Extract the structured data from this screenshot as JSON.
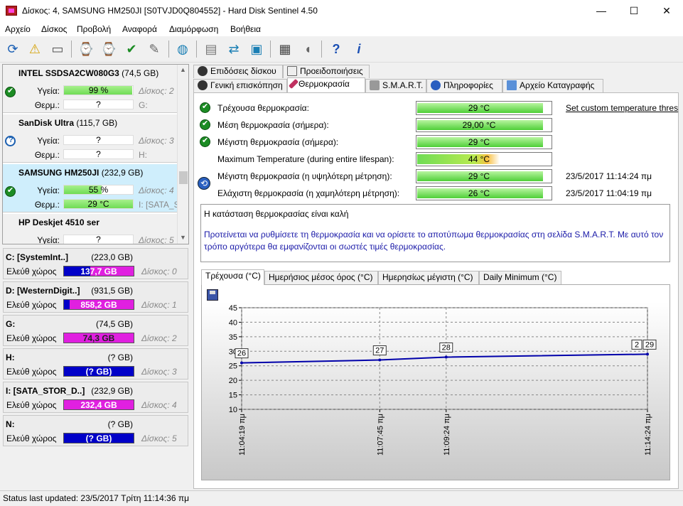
{
  "window": {
    "title": "Δίσκος: 4, SAMSUNG HM250JI [S0TVJD0Q804552]  -  Hard Disk Sentinel 4.50",
    "minimize": "—",
    "maximize": "☐",
    "close": "✕"
  },
  "menu": [
    {
      "label": "Αρχείο"
    },
    {
      "label": "Δίσκος"
    },
    {
      "label": "Προβολή"
    },
    {
      "label": "Αναφορά"
    },
    {
      "label": "Διαμόρφωση"
    },
    {
      "label": "Βοήθεια"
    }
  ],
  "toolbar": {
    "icons": [
      "refresh-icon",
      "warning-icon",
      "disk-icon",
      "disk-test-icon",
      "disk-test-icon",
      "disk-ok-icon",
      "disk-config-icon",
      "globe-icon",
      "report-icon",
      "sync-icon",
      "network-icon",
      "monitor-icon",
      "speaker-icon",
      "help-icon",
      "info-icon"
    ],
    "glyphs": [
      "⟳",
      "⚠",
      "▭",
      "⌚",
      "⌚",
      "✔",
      "✎",
      "◍",
      "▤",
      "⇄",
      "▣",
      "▦",
      "◖",
      "?",
      "i"
    ]
  },
  "disks": [
    {
      "name": "INTEL SSDSA2CW080G3",
      "capacity": "(74,5 GB)",
      "health_label": "Υγεία:",
      "health": "99 %",
      "health_pct": 99,
      "temp_label": "Θερμ.:",
      "temp": "?",
      "temp_pct": 0,
      "disk_no": "Δίσκος: 2",
      "drive": "G:",
      "status": "ok"
    },
    {
      "name": "SanDisk Ultra",
      "capacity": "(115,7 GB)",
      "health_label": "Υγεία:",
      "health": "?",
      "health_pct": 0,
      "temp_label": "Θερμ.:",
      "temp": "?",
      "temp_pct": 0,
      "disk_no": "Δίσκος: 3",
      "drive": "H:",
      "status": "unknown"
    },
    {
      "name": "SAMSUNG HM250JI",
      "capacity": "(232,9 GB)",
      "health_label": "Υγεία:",
      "health": "55 %",
      "health_pct": 55,
      "temp_label": "Θερμ.:",
      "temp": "29 °C",
      "temp_pct": 100,
      "disk_no": "Δίσκος: 4",
      "drive": "I: [SATA_S",
      "status": "ok"
    },
    {
      "name": "HP      Deskjet 4510 ser",
      "capacity": "",
      "health_label": "Υγεία:",
      "health": "?",
      "health_pct": 0,
      "temp_label": "",
      "temp": "",
      "temp_pct": 0,
      "disk_no": "Δίσκος: 5",
      "drive": "",
      "status": "unknown"
    }
  ],
  "volumes": [
    {
      "name": "C: [SystemInt..]",
      "size": "(223,0 GB)",
      "free_label": "Ελεύθ χώρος",
      "free": "137,7 GB",
      "free_pct": 62,
      "color": "#e020e0",
      "disk": "Δίσκος: 0"
    },
    {
      "name": "D: [WesternDigit..]",
      "size": "(931,5 GB)",
      "free_label": "Ελεύθ χώρος",
      "free": "858,2 GB",
      "free_pct": 92,
      "color": "#e020e0",
      "disk": "Δίσκος: 1"
    },
    {
      "name": "G:",
      "size": "(74,5 GB)",
      "free_label": "Ελεύθ χώρος",
      "free": "74,3 GB",
      "free_pct": 100,
      "color": "#e020e0",
      "disk": "Δίσκος: 2"
    },
    {
      "name": "H:",
      "size": "(? GB)",
      "free_label": "Ελεύθ χώρος",
      "free": "(? GB)",
      "free_pct": 0,
      "color": "#e020e0",
      "disk": "Δίσκος: 3"
    },
    {
      "name": "I: [SATA_STOR_D..]",
      "size": "(232,9 GB)",
      "free_label": "Ελεύθ χώρος",
      "free": "232,4 GB",
      "free_pct": 100,
      "color": "#e020e0",
      "disk": "Δίσκος: 4"
    },
    {
      "name": "N:",
      "size": "(? GB)",
      "free_label": "Ελεύθ χώρος",
      "free": "(? GB)",
      "free_pct": 0,
      "color": "#e020e0",
      "disk": "Δίσκος: 5"
    }
  ],
  "tabs_top": [
    {
      "label": "Επιδόσεις δίσκου",
      "icon": "gauge-icon"
    },
    {
      "label": "Προειδοποιήσεις",
      "icon": "document-icon"
    }
  ],
  "tabs_main": [
    {
      "label": "Γενική επισκόπηση",
      "icon": "gauge-icon"
    },
    {
      "label": "Θερμοκρασία",
      "icon": "thermometer-icon",
      "active": true
    },
    {
      "label": "S.M.A.R.T.",
      "icon": "disk-icon"
    },
    {
      "label": "Πληροφορίες",
      "icon": "info-icon"
    },
    {
      "label": "Αρχείο Καταγραφής",
      "icon": "log-icon"
    }
  ],
  "temps": [
    {
      "label": "Τρέχουσα θερμοκρασία:",
      "value": "29 °C",
      "fill_pct": 93,
      "ok": true,
      "extra": "Set custom temperature thres"
    },
    {
      "label": "Μέση θερμοκρασία (σήμερα):",
      "value": "29,00 °C",
      "fill_pct": 93,
      "ok": true,
      "extra": ""
    },
    {
      "label": "Μέγιστη θερμοκρασία (σήμερα):",
      "value": "29 °C",
      "fill_pct": 93,
      "ok": true,
      "extra": ""
    },
    {
      "label": "Maximum Temperature (during entire lifespan):",
      "value": "44 °C",
      "fill_pct": 76,
      "ok": false,
      "warm": true,
      "extra": ""
    },
    {
      "label": "Μέγιστη θερμοκρασία (η υψηλότερη μέτρηση):",
      "value": "29 °C",
      "fill_pct": 93,
      "ok": false,
      "extra": "23/5/2017 11:14:24 πμ"
    },
    {
      "label": "Ελάχιστη θερμοκρασία (η χαμηλότερη μέτρηση):",
      "value": "26 °C",
      "fill_pct": 93,
      "ok": false,
      "extra": "23/5/2017 11:04:19 πμ"
    }
  ],
  "info": {
    "status": "Η κατάσταση θερμοκρασίας είναι καλή",
    "advice": "Προτείνεται να ρυθμίσετε τη θερμοκρασία και να ορίσετε το αποτύπωμα θερμοκρασίας στη σελίδα S.M.A.R.T. Με αυτό τον τρόπο αργότερα θα εμφανίζονται οι σωστές τιμές θερμοκρασίας."
  },
  "graph_tabs": [
    {
      "label": "Τρέχουσα (°C)",
      "active": true
    },
    {
      "label": "Ημερήσιος μέσος όρος (°C)"
    },
    {
      "label": "Ημερησίως μέγιστη (°C)"
    },
    {
      "label": "Daily Minimum (°C)"
    }
  ],
  "chart_data": {
    "type": "line",
    "x": [
      "11:04:19 πμ",
      "11:07:45 πμ",
      "11:09:24 πμ",
      "11:14:24 πμ"
    ],
    "x_minutes": [
      0,
      3.43,
      5.08,
      10.08
    ],
    "series": [
      {
        "name": "",
        "values": [
          26,
          27,
          28,
          29
        ]
      }
    ],
    "point_labels": [
      "26",
      "27",
      "28",
      "29"
    ],
    "extra_label": "2",
    "yticks": [
      10,
      15,
      20,
      25,
      30,
      35,
      40,
      45
    ],
    "ylim": [
      10,
      45
    ],
    "grid": true,
    "line_color": "#0000aa"
  },
  "statusbar": {
    "text": "Status last updated: 23/5/2017 Τρίτη 11:14:36 πμ"
  }
}
